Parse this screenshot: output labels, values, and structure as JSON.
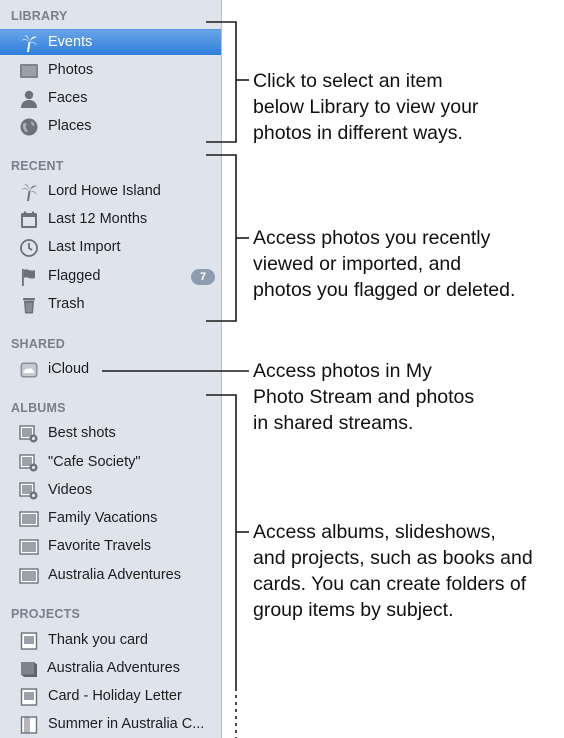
{
  "sidebar": {
    "sections": {
      "library": "LIBRARY",
      "recent": "RECENT",
      "shared": "SHARED",
      "albums": "ALBUMS",
      "projects": "PROJECTS"
    },
    "library": [
      {
        "label": "Events",
        "icon": "palm-tree-icon",
        "selected": true
      },
      {
        "label": "Photos",
        "icon": "photo-icon"
      },
      {
        "label": "Faces",
        "icon": "person-icon"
      },
      {
        "label": "Places",
        "icon": "globe-icon"
      }
    ],
    "recent": [
      {
        "label": "Lord Howe Island",
        "icon": "palm-tree-icon"
      },
      {
        "label": "Last 12 Months",
        "icon": "calendar-icon"
      },
      {
        "label": "Last Import",
        "icon": "clock-icon"
      },
      {
        "label": "Flagged",
        "icon": "flag-icon",
        "badge": "7"
      },
      {
        "label": "Trash",
        "icon": "trash-icon"
      }
    ],
    "shared": [
      {
        "label": "iCloud",
        "icon": "cloud-icon"
      }
    ],
    "albums": [
      {
        "label": "Best shots",
        "icon": "smart-album-icon"
      },
      {
        "label": "\"Cafe Society\"",
        "icon": "smart-album-icon"
      },
      {
        "label": "Videos",
        "icon": "smart-album-icon"
      },
      {
        "label": "Family Vacations",
        "icon": "album-icon"
      },
      {
        "label": "Favorite Travels",
        "icon": "album-icon"
      },
      {
        "label": "Australia Adventures",
        "icon": "album-icon"
      }
    ],
    "projects": [
      {
        "label": "Thank you card",
        "icon": "card-icon"
      },
      {
        "label": "Australia Adventures",
        "icon": "book-icon"
      },
      {
        "label": "Card - Holiday Letter",
        "icon": "card-icon"
      },
      {
        "label": "Summer in Australia C...",
        "icon": "calendar-project-icon"
      }
    ]
  },
  "callouts": {
    "library": [
      "Click to select an item",
      "below Library to view your",
      "photos in different ways."
    ],
    "recent": [
      "Access photos you recently",
      "viewed or imported, and",
      "photos you flagged or deleted."
    ],
    "shared": [
      "Access photos in My",
      "Photo Stream and photos",
      "in shared streams."
    ],
    "albums": [
      "Access albums, slideshows,",
      "and projects, such as books and",
      "cards. You can create folders of",
      "group items by subject."
    ]
  },
  "colors": {
    "sidebar_bg": "#dfe4ec",
    "selection": "#2f7fdc",
    "header_text": "#77808c",
    "badge": "#8e9cb1"
  }
}
